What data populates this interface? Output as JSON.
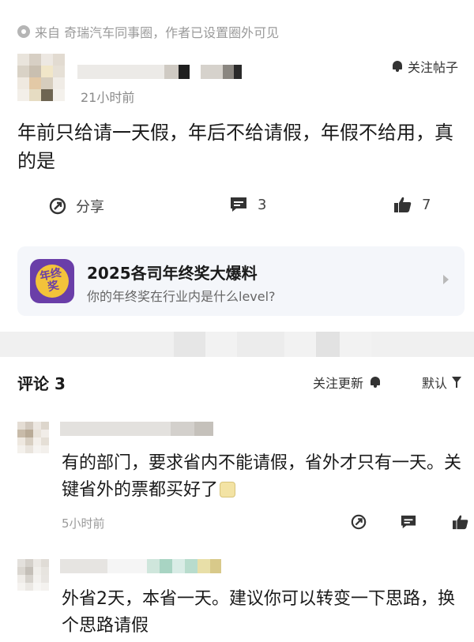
{
  "source": {
    "text": "来自 奇瑞汽车同事圈，作者已设置圈外可见"
  },
  "post": {
    "time": "21小时前",
    "follow_label": "关注帖子",
    "content": "年前只给请一天假，年后不给请假，年假不给用，真的是",
    "share_label": "分享",
    "comment_count": "3",
    "like_count": "7"
  },
  "promo": {
    "icon_text": "年终奖",
    "title": "2025各司年终奖大爆料",
    "subtitle": "你的年终奖在行业内是什么level?"
  },
  "comments_section": {
    "title": "评论 3",
    "follow_updates_label": "关注更新",
    "sort_label": "默认"
  },
  "comments": [
    {
      "text": "有的部门，要求省内不能请假，省外才只有一天。关键省外的票都买好了",
      "time": "5小时前"
    },
    {
      "text": "外省2天，本省一天。建议你可以转变一下思路，换个思路请假"
    }
  ],
  "colors": {
    "accent_purple": "#6a3ea8",
    "accent_yellow": "#f3c33a",
    "text_primary": "#1a1a1a",
    "text_muted": "#9a9a9a",
    "card_bg": "#f4f6fa"
  },
  "icons": [
    "circle-icon",
    "bell-icon",
    "share-icon",
    "comment-icon",
    "thumbs-up-icon",
    "chevron-right-icon",
    "filter-icon"
  ]
}
